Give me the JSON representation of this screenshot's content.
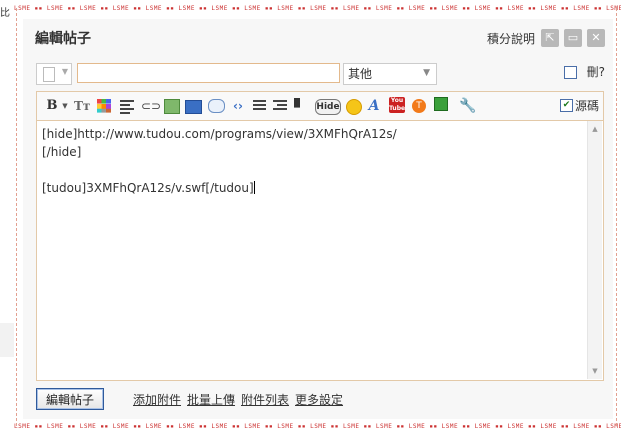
{
  "page": {
    "corner_label": "比"
  },
  "border": {
    "stamp": "LSME"
  },
  "dialog": {
    "title": "編輯帖子",
    "help_link": "積分說明",
    "popout_icon": "popout-icon",
    "maximize_icon": "maximize-icon",
    "close_icon": "close-icon"
  },
  "post": {
    "type_icon": "document-icon",
    "subject_value": "",
    "category_selected": "其他",
    "delete_label": "刪?",
    "delete_checked": false
  },
  "toolbar": {
    "bold_label": "B",
    "fontsize_label": "Tт",
    "hide_label": "Hide",
    "font_label": "A",
    "youtube_label": "You Tube",
    "tudou_label": "T",
    "source_label": "源碼",
    "source_checked": true,
    "icons": [
      "bold-icon",
      "font-size-icon",
      "color-icon",
      "align-icon",
      "link-icon",
      "image-icon",
      "media-icon",
      "quote-icon",
      "code-icon",
      "ordered-list-icon",
      "unordered-list-icon",
      "float-icon",
      "hide-icon",
      "smiley-icon",
      "font-icon",
      "youtube-icon",
      "tudou-icon",
      "table-icon",
      "wrench-icon"
    ]
  },
  "editor": {
    "lines": [
      "[hide]http://www.tudou.com/programs/view/3XMFhQrA12s/",
      "[/hide]",
      "",
      "[tudou]3XMFhQrA12s/v.swf[/tudou]"
    ]
  },
  "footer": {
    "submit_label": "編輯帖子",
    "attach_label": "添加附件",
    "batch_upload_label": "批量上傳",
    "attachment_list_label": "附件列表",
    "more_settings_label": "更多設定"
  }
}
